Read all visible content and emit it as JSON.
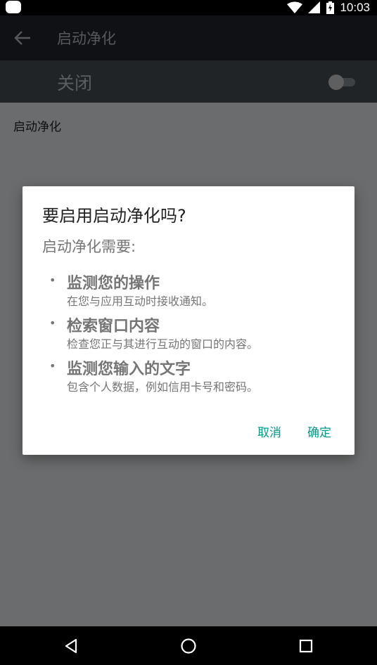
{
  "status_bar": {
    "time": "10:03",
    "icons": [
      "notification-icon",
      "wifi-icon",
      "signal-icon",
      "battery-charging-icon"
    ]
  },
  "app_bar": {
    "title": "启动净化",
    "back_icon": "arrow-back-icon"
  },
  "switch_bar": {
    "label": "关闭",
    "toggle_on": false
  },
  "content": {
    "description": "启动净化"
  },
  "dialog": {
    "title": "要启用启动净化吗?",
    "subtitle": "启动净化需要:",
    "bullet": "•",
    "permissions": [
      {
        "title": "监测您的操作",
        "description": "在您与应用互动时接收通知。"
      },
      {
        "title": "检索窗口内容",
        "description": "检查您正与其进行互动的窗口的内容。"
      },
      {
        "title": "监测您输入的文字",
        "description": "包含个人数据，例如信用卡号和密码。"
      }
    ],
    "cancel_label": "取消",
    "ok_label": "确定"
  },
  "nav_bar": {
    "icons": [
      "back-triangle-icon",
      "home-circle-icon",
      "recents-square-icon"
    ]
  },
  "colors": {
    "accent": "#009688",
    "dialog_text": "#757575",
    "appbar_bg": "#0f1114",
    "switchbar_bg": "#202427",
    "content_bg": "#6a6c6d"
  }
}
